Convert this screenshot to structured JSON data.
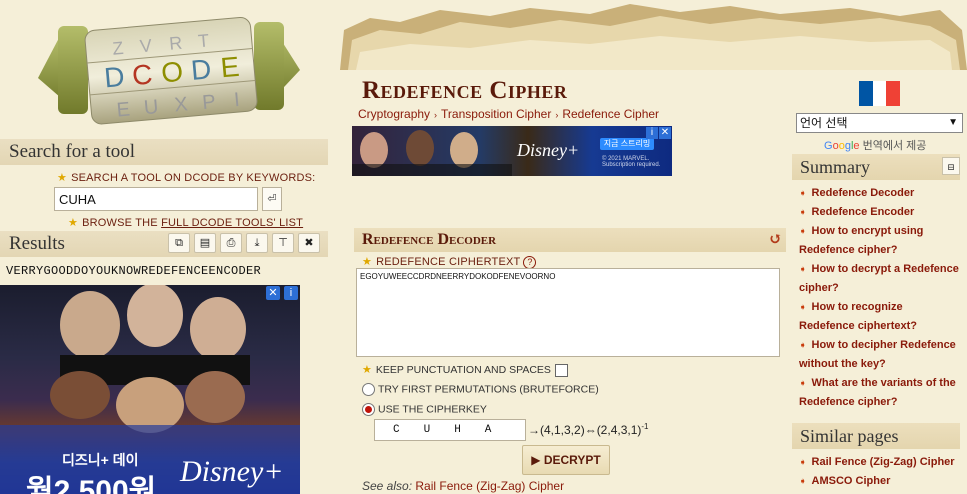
{
  "logo": {
    "letters": "DCODE",
    "alt_rows": [
      "ZVRT",
      "EUXPI"
    ]
  },
  "left": {
    "search_title": "Search for a tool",
    "search_label": "Search a tool on dCode by keywords:",
    "search_value": "CUHA",
    "go_icon": "enter-icon",
    "browse_prefix": "Browse the",
    "browse_link": "full dCode tools' list",
    "results_title": "Results",
    "results_buttons": [
      "copy-icon",
      "save-icon",
      "print-icon",
      "download-icon",
      "pin-icon",
      "close-icon"
    ],
    "results_text": "VERRYGOODDOYOUKNOWREDEFENCEENCODER",
    "ad": {
      "line1": "디즈니+ 데이",
      "line2": "월2,500원",
      "brand": "Disney+"
    }
  },
  "center": {
    "title": "Redefence Cipher",
    "breadcrumb": [
      "Cryptography",
      "Transposition Cipher",
      "Redefence Cipher"
    ],
    "ad": {
      "brand": "Disney+",
      "button": "지금 스트리밍",
      "copyright": "© 2021 MARVEL. Subscription required."
    },
    "decoder": {
      "title": "Redefence Decoder",
      "ciphertext_label": "Redefence ciphertext",
      "help": "?",
      "ciphertext": "EGOYUWEECCDRDNEERRYDOKODFENEVOORNO",
      "keep_punct_label": "Keep punctuation and spaces",
      "bruteforce_label": "Try first permutations (bruteforce)",
      "cipherkey_label": "Use the cipherkey",
      "key_value": "CUHA",
      "perm_text": "→(4,1,3,2)⇔(2,4,3,1)",
      "perm_exp": "-1",
      "decrypt_label": "▶ DECRYPT",
      "see_also_prefix": "See also:",
      "see_also_link": "Rail Fence (Zig-Zag) Cipher"
    }
  },
  "right": {
    "flag_colors": [
      "#0055a4",
      "#ffffff",
      "#ef4135"
    ],
    "lang_select": "언어 선택",
    "gt_suffix": "번역에서 제공",
    "summary_title": "Summary",
    "summary_items": [
      "Redefence Decoder",
      "Redefence Encoder",
      "How to encrypt using Redefence cipher?",
      "How to decrypt a Redefence cipher?",
      "How to recognize Redefence ciphertext?",
      "How to decipher Redefence without the key?",
      "What are the variants of the Redefence cipher?"
    ],
    "similar_title": "Similar pages",
    "similar_items": [
      "Rail Fence (Zig-Zag) Cipher",
      "AMSCO Cipher"
    ]
  }
}
